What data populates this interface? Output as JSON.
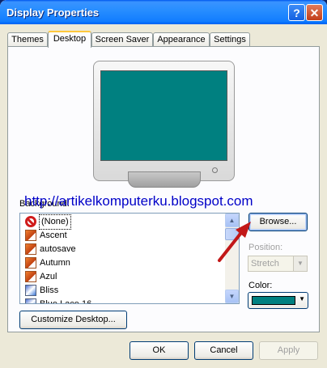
{
  "window": {
    "title": "Display Properties",
    "help_glyph": "?",
    "close_glyph": "✕"
  },
  "tabs": [
    {
      "label": "Themes"
    },
    {
      "label": "Desktop"
    },
    {
      "label": "Screen Saver"
    },
    {
      "label": "Appearance"
    },
    {
      "label": "Settings"
    }
  ],
  "watermark": "http://artikelkomputerku.blogspot.com",
  "background": {
    "label": "Background:",
    "items": [
      {
        "label": "(None)",
        "icon": "none-icon"
      },
      {
        "label": "Ascent",
        "icon": "image-icon"
      },
      {
        "label": "autosave",
        "icon": "image-icon"
      },
      {
        "label": "Autumn",
        "icon": "image-icon"
      },
      {
        "label": "Azul",
        "icon": "image-icon"
      },
      {
        "label": "Bliss",
        "icon": "bitmap-icon"
      },
      {
        "label": "Blue Lace 16",
        "icon": "bitmap-icon"
      }
    ],
    "selected": "(None)"
  },
  "buttons": {
    "browse": "Browse...",
    "customize": "Customize Desktop...",
    "ok": "OK",
    "cancel": "Cancel",
    "apply": "Apply"
  },
  "position": {
    "label": "Position:",
    "value": "Stretch"
  },
  "color": {
    "label": "Color:",
    "value": "#008080"
  },
  "scrollbar": {
    "up": "▲",
    "down": "▼"
  },
  "dropdown_glyph": "▼"
}
